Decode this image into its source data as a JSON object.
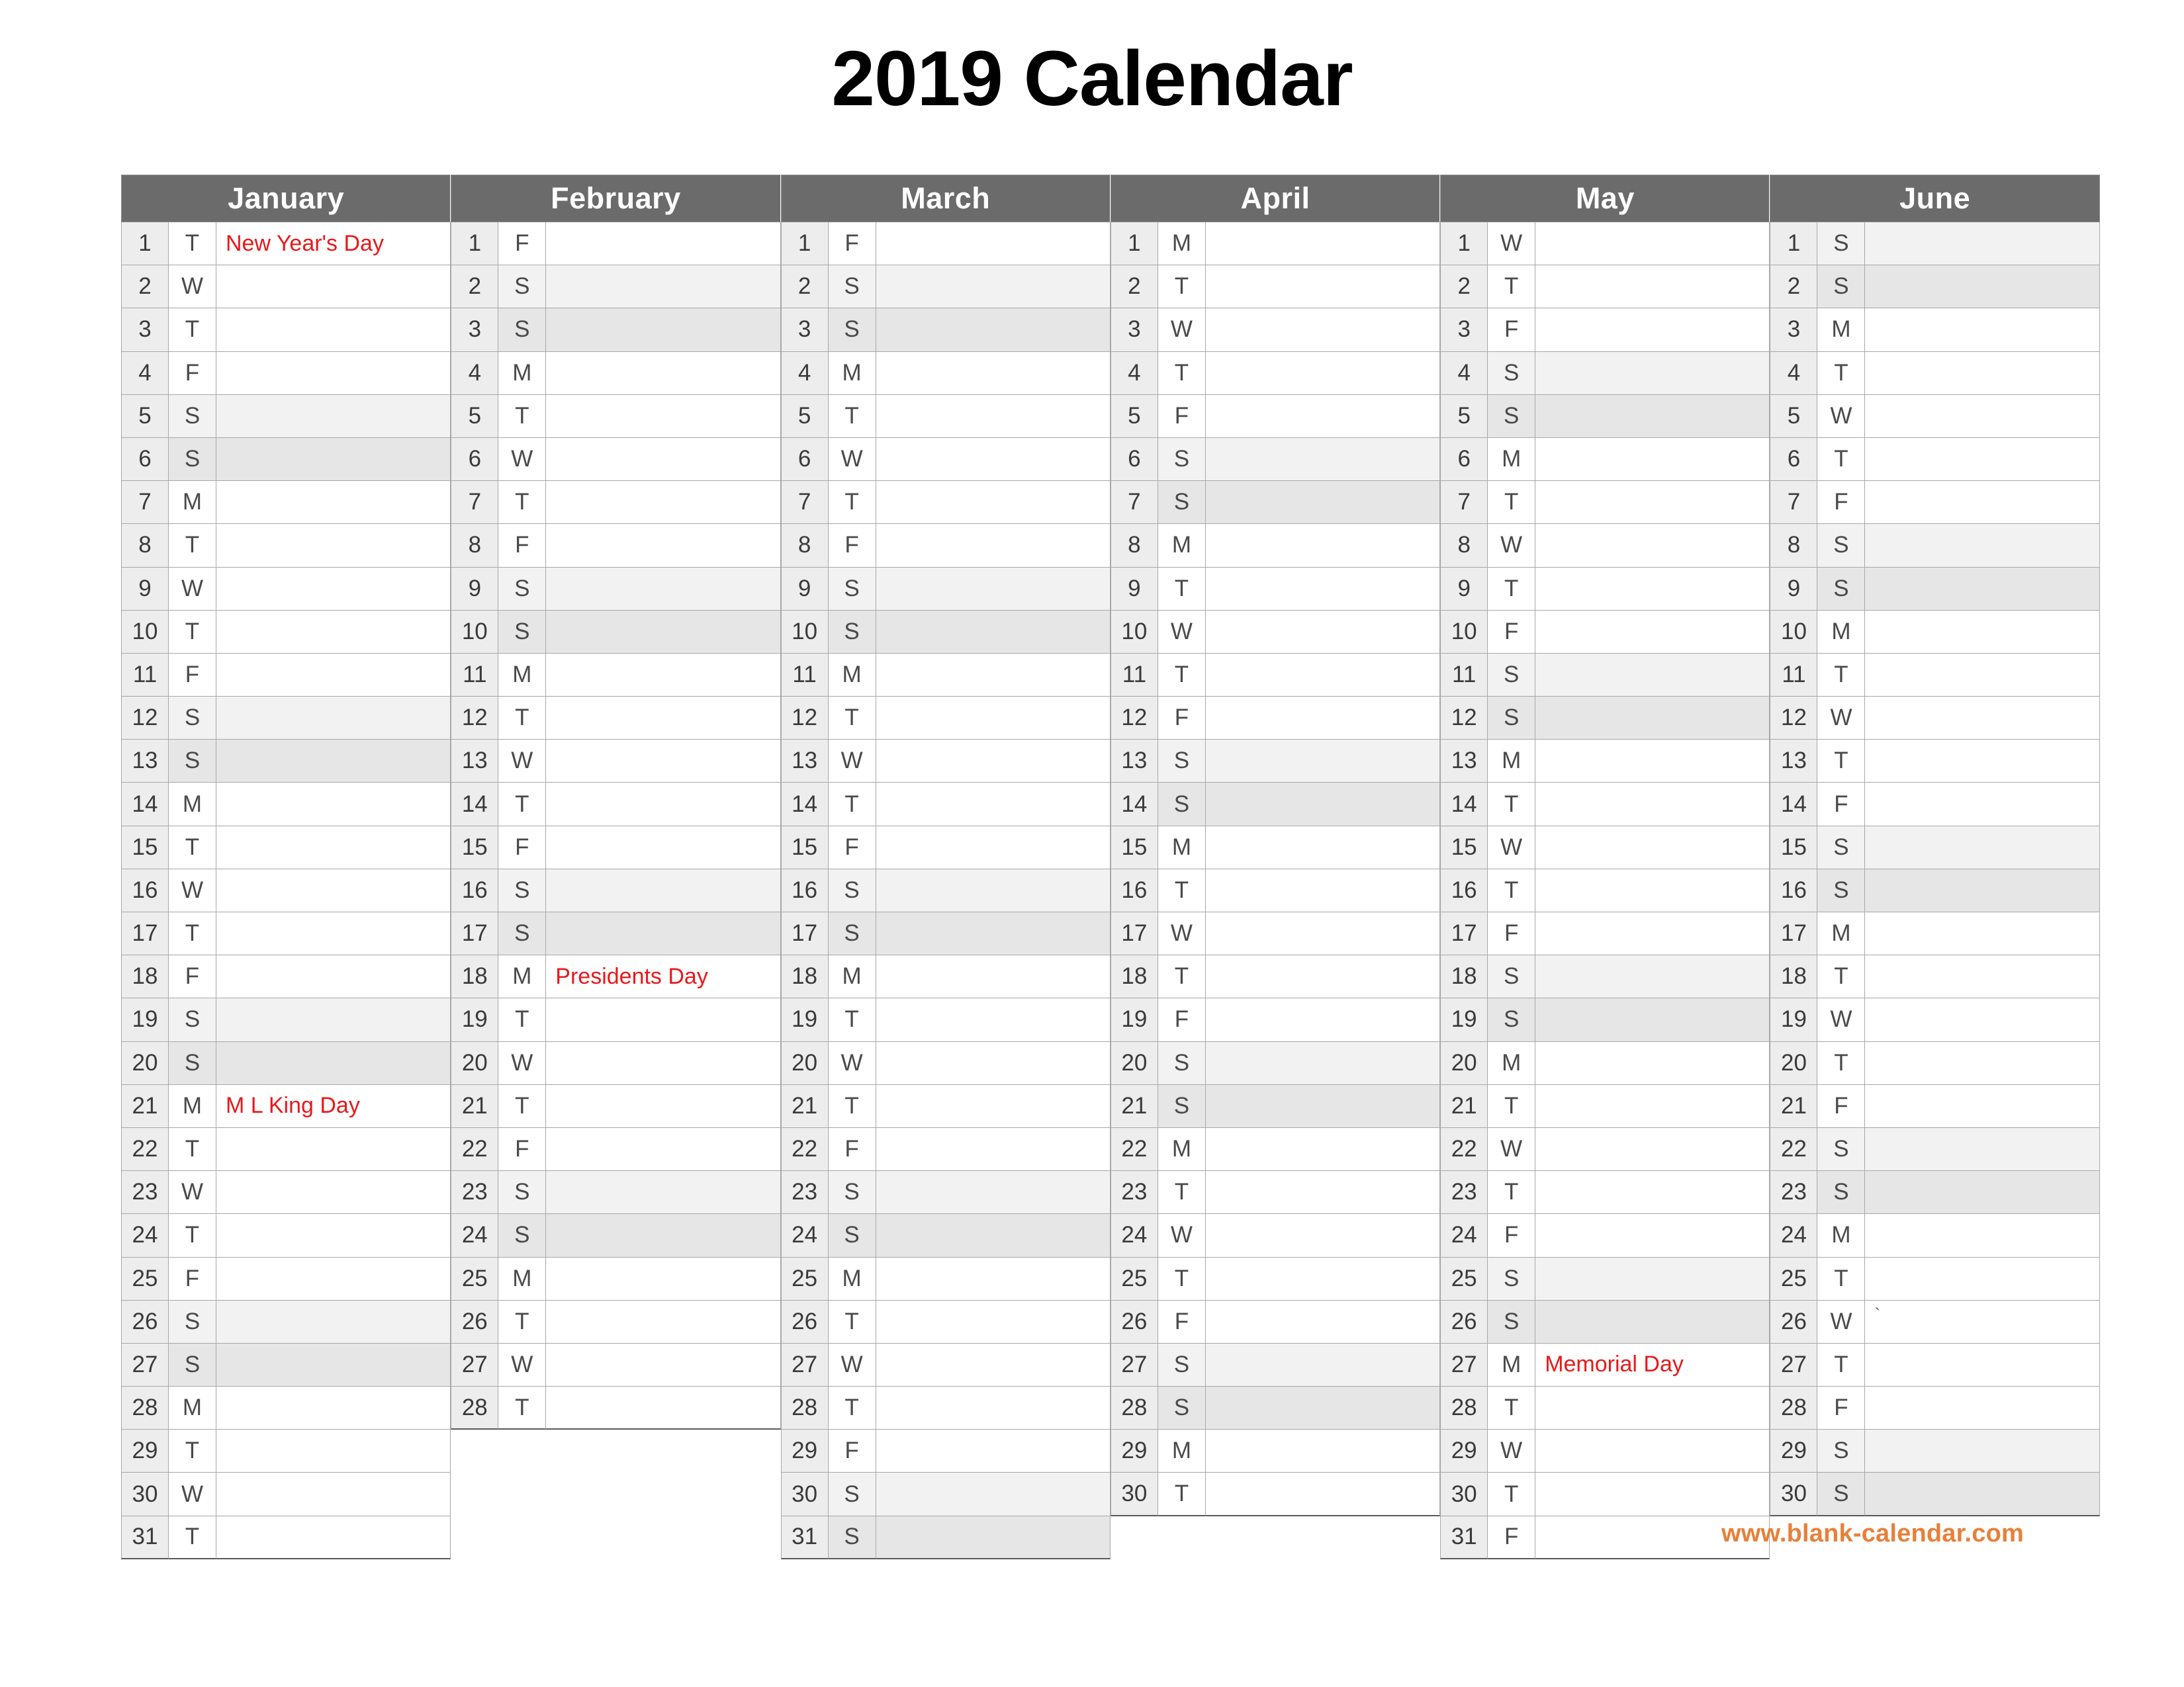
{
  "page": {
    "title": "2019 Calendar",
    "footer_url": "www.blank-calendar.com"
  },
  "colors": {
    "header_bg": "#6b6b6b",
    "header_text": "#ffffff",
    "daynum_bg": "#ededed",
    "saturday_bg": "#f2f2f2",
    "sunday_bg": "#e6e6e6",
    "holiday_text": "#e8191b",
    "url_text": "#e8803a",
    "grid_line": "#a8a8a8",
    "page_bg": "#ffffff"
  },
  "months": [
    {
      "name": "January",
      "num_days": 31,
      "days": [
        {
          "n": 1,
          "dow": "T",
          "event": "New Year's Day",
          "holiday": true
        },
        {
          "n": 2,
          "dow": "W",
          "event": ""
        },
        {
          "n": 3,
          "dow": "T",
          "event": ""
        },
        {
          "n": 4,
          "dow": "F",
          "event": ""
        },
        {
          "n": 5,
          "dow": "S",
          "event": "",
          "weekend": "sat"
        },
        {
          "n": 6,
          "dow": "S",
          "event": "",
          "weekend": "sun"
        },
        {
          "n": 7,
          "dow": "M",
          "event": ""
        },
        {
          "n": 8,
          "dow": "T",
          "event": ""
        },
        {
          "n": 9,
          "dow": "W",
          "event": ""
        },
        {
          "n": 10,
          "dow": "T",
          "event": ""
        },
        {
          "n": 11,
          "dow": "F",
          "event": ""
        },
        {
          "n": 12,
          "dow": "S",
          "event": "",
          "weekend": "sat"
        },
        {
          "n": 13,
          "dow": "S",
          "event": "",
          "weekend": "sun"
        },
        {
          "n": 14,
          "dow": "M",
          "event": ""
        },
        {
          "n": 15,
          "dow": "T",
          "event": ""
        },
        {
          "n": 16,
          "dow": "W",
          "event": ""
        },
        {
          "n": 17,
          "dow": "T",
          "event": ""
        },
        {
          "n": 18,
          "dow": "F",
          "event": ""
        },
        {
          "n": 19,
          "dow": "S",
          "event": "",
          "weekend": "sat"
        },
        {
          "n": 20,
          "dow": "S",
          "event": "",
          "weekend": "sun"
        },
        {
          "n": 21,
          "dow": "M",
          "event": "M L King Day",
          "holiday": true
        },
        {
          "n": 22,
          "dow": "T",
          "event": ""
        },
        {
          "n": 23,
          "dow": "W",
          "event": ""
        },
        {
          "n": 24,
          "dow": "T",
          "event": ""
        },
        {
          "n": 25,
          "dow": "F",
          "event": ""
        },
        {
          "n": 26,
          "dow": "S",
          "event": "",
          "weekend": "sat"
        },
        {
          "n": 27,
          "dow": "S",
          "event": "",
          "weekend": "sun"
        },
        {
          "n": 28,
          "dow": "M",
          "event": ""
        },
        {
          "n": 29,
          "dow": "T",
          "event": ""
        },
        {
          "n": 30,
          "dow": "W",
          "event": ""
        },
        {
          "n": 31,
          "dow": "T",
          "event": ""
        }
      ]
    },
    {
      "name": "February",
      "num_days": 28,
      "days": [
        {
          "n": 1,
          "dow": "F",
          "event": ""
        },
        {
          "n": 2,
          "dow": "S",
          "event": "",
          "weekend": "sat"
        },
        {
          "n": 3,
          "dow": "S",
          "event": "",
          "weekend": "sun"
        },
        {
          "n": 4,
          "dow": "M",
          "event": ""
        },
        {
          "n": 5,
          "dow": "T",
          "event": ""
        },
        {
          "n": 6,
          "dow": "W",
          "event": ""
        },
        {
          "n": 7,
          "dow": "T",
          "event": ""
        },
        {
          "n": 8,
          "dow": "F",
          "event": ""
        },
        {
          "n": 9,
          "dow": "S",
          "event": "",
          "weekend": "sat"
        },
        {
          "n": 10,
          "dow": "S",
          "event": "",
          "weekend": "sun"
        },
        {
          "n": 11,
          "dow": "M",
          "event": ""
        },
        {
          "n": 12,
          "dow": "T",
          "event": ""
        },
        {
          "n": 13,
          "dow": "W",
          "event": ""
        },
        {
          "n": 14,
          "dow": "T",
          "event": ""
        },
        {
          "n": 15,
          "dow": "F",
          "event": ""
        },
        {
          "n": 16,
          "dow": "S",
          "event": "",
          "weekend": "sat"
        },
        {
          "n": 17,
          "dow": "S",
          "event": "",
          "weekend": "sun"
        },
        {
          "n": 18,
          "dow": "M",
          "event": "Presidents Day",
          "holiday": true
        },
        {
          "n": 19,
          "dow": "T",
          "event": ""
        },
        {
          "n": 20,
          "dow": "W",
          "event": ""
        },
        {
          "n": 21,
          "dow": "T",
          "event": ""
        },
        {
          "n": 22,
          "dow": "F",
          "event": ""
        },
        {
          "n": 23,
          "dow": "S",
          "event": "",
          "weekend": "sat"
        },
        {
          "n": 24,
          "dow": "S",
          "event": "",
          "weekend": "sun"
        },
        {
          "n": 25,
          "dow": "M",
          "event": ""
        },
        {
          "n": 26,
          "dow": "T",
          "event": ""
        },
        {
          "n": 27,
          "dow": "W",
          "event": ""
        },
        {
          "n": 28,
          "dow": "T",
          "event": ""
        }
      ]
    },
    {
      "name": "March",
      "num_days": 31,
      "days": [
        {
          "n": 1,
          "dow": "F",
          "event": ""
        },
        {
          "n": 2,
          "dow": "S",
          "event": "",
          "weekend": "sat"
        },
        {
          "n": 3,
          "dow": "S",
          "event": "",
          "weekend": "sun"
        },
        {
          "n": 4,
          "dow": "M",
          "event": ""
        },
        {
          "n": 5,
          "dow": "T",
          "event": ""
        },
        {
          "n": 6,
          "dow": "W",
          "event": ""
        },
        {
          "n": 7,
          "dow": "T",
          "event": ""
        },
        {
          "n": 8,
          "dow": "F",
          "event": ""
        },
        {
          "n": 9,
          "dow": "S",
          "event": "",
          "weekend": "sat"
        },
        {
          "n": 10,
          "dow": "S",
          "event": "",
          "weekend": "sun"
        },
        {
          "n": 11,
          "dow": "M",
          "event": ""
        },
        {
          "n": 12,
          "dow": "T",
          "event": ""
        },
        {
          "n": 13,
          "dow": "W",
          "event": ""
        },
        {
          "n": 14,
          "dow": "T",
          "event": ""
        },
        {
          "n": 15,
          "dow": "F",
          "event": ""
        },
        {
          "n": 16,
          "dow": "S",
          "event": "",
          "weekend": "sat"
        },
        {
          "n": 17,
          "dow": "S",
          "event": "",
          "weekend": "sun"
        },
        {
          "n": 18,
          "dow": "M",
          "event": ""
        },
        {
          "n": 19,
          "dow": "T",
          "event": ""
        },
        {
          "n": 20,
          "dow": "W",
          "event": ""
        },
        {
          "n": 21,
          "dow": "T",
          "event": ""
        },
        {
          "n": 22,
          "dow": "F",
          "event": ""
        },
        {
          "n": 23,
          "dow": "S",
          "event": "",
          "weekend": "sat"
        },
        {
          "n": 24,
          "dow": "S",
          "event": "",
          "weekend": "sun"
        },
        {
          "n": 25,
          "dow": "M",
          "event": ""
        },
        {
          "n": 26,
          "dow": "T",
          "event": ""
        },
        {
          "n": 27,
          "dow": "W",
          "event": ""
        },
        {
          "n": 28,
          "dow": "T",
          "event": ""
        },
        {
          "n": 29,
          "dow": "F",
          "event": ""
        },
        {
          "n": 30,
          "dow": "S",
          "event": "",
          "weekend": "sat"
        },
        {
          "n": 31,
          "dow": "S",
          "event": "",
          "weekend": "sun"
        }
      ]
    },
    {
      "name": "April",
      "num_days": 30,
      "days": [
        {
          "n": 1,
          "dow": "M",
          "event": ""
        },
        {
          "n": 2,
          "dow": "T",
          "event": ""
        },
        {
          "n": 3,
          "dow": "W",
          "event": ""
        },
        {
          "n": 4,
          "dow": "T",
          "event": ""
        },
        {
          "n": 5,
          "dow": "F",
          "event": ""
        },
        {
          "n": 6,
          "dow": "S",
          "event": "",
          "weekend": "sat"
        },
        {
          "n": 7,
          "dow": "S",
          "event": "",
          "weekend": "sun"
        },
        {
          "n": 8,
          "dow": "M",
          "event": ""
        },
        {
          "n": 9,
          "dow": "T",
          "event": ""
        },
        {
          "n": 10,
          "dow": "W",
          "event": ""
        },
        {
          "n": 11,
          "dow": "T",
          "event": ""
        },
        {
          "n": 12,
          "dow": "F",
          "event": ""
        },
        {
          "n": 13,
          "dow": "S",
          "event": "",
          "weekend": "sat"
        },
        {
          "n": 14,
          "dow": "S",
          "event": "",
          "weekend": "sun"
        },
        {
          "n": 15,
          "dow": "M",
          "event": ""
        },
        {
          "n": 16,
          "dow": "T",
          "event": ""
        },
        {
          "n": 17,
          "dow": "W",
          "event": ""
        },
        {
          "n": 18,
          "dow": "T",
          "event": ""
        },
        {
          "n": 19,
          "dow": "F",
          "event": ""
        },
        {
          "n": 20,
          "dow": "S",
          "event": "",
          "weekend": "sat"
        },
        {
          "n": 21,
          "dow": "S",
          "event": "",
          "weekend": "sun"
        },
        {
          "n": 22,
          "dow": "M",
          "event": ""
        },
        {
          "n": 23,
          "dow": "T",
          "event": ""
        },
        {
          "n": 24,
          "dow": "W",
          "event": ""
        },
        {
          "n": 25,
          "dow": "T",
          "event": ""
        },
        {
          "n": 26,
          "dow": "F",
          "event": ""
        },
        {
          "n": 27,
          "dow": "S",
          "event": "",
          "weekend": "sat"
        },
        {
          "n": 28,
          "dow": "S",
          "event": "",
          "weekend": "sun"
        },
        {
          "n": 29,
          "dow": "M",
          "event": ""
        },
        {
          "n": 30,
          "dow": "T",
          "event": ""
        }
      ]
    },
    {
      "name": "May",
      "num_days": 31,
      "days": [
        {
          "n": 1,
          "dow": "W",
          "event": ""
        },
        {
          "n": 2,
          "dow": "T",
          "event": ""
        },
        {
          "n": 3,
          "dow": "F",
          "event": ""
        },
        {
          "n": 4,
          "dow": "S",
          "event": "",
          "weekend": "sat"
        },
        {
          "n": 5,
          "dow": "S",
          "event": "",
          "weekend": "sun"
        },
        {
          "n": 6,
          "dow": "M",
          "event": ""
        },
        {
          "n": 7,
          "dow": "T",
          "event": ""
        },
        {
          "n": 8,
          "dow": "W",
          "event": ""
        },
        {
          "n": 9,
          "dow": "T",
          "event": ""
        },
        {
          "n": 10,
          "dow": "F",
          "event": ""
        },
        {
          "n": 11,
          "dow": "S",
          "event": "",
          "weekend": "sat"
        },
        {
          "n": 12,
          "dow": "S",
          "event": "",
          "weekend": "sun"
        },
        {
          "n": 13,
          "dow": "M",
          "event": ""
        },
        {
          "n": 14,
          "dow": "T",
          "event": ""
        },
        {
          "n": 15,
          "dow": "W",
          "event": ""
        },
        {
          "n": 16,
          "dow": "T",
          "event": ""
        },
        {
          "n": 17,
          "dow": "F",
          "event": ""
        },
        {
          "n": 18,
          "dow": "S",
          "event": "",
          "weekend": "sat"
        },
        {
          "n": 19,
          "dow": "S",
          "event": "",
          "weekend": "sun"
        },
        {
          "n": 20,
          "dow": "M",
          "event": ""
        },
        {
          "n": 21,
          "dow": "T",
          "event": ""
        },
        {
          "n": 22,
          "dow": "W",
          "event": ""
        },
        {
          "n": 23,
          "dow": "T",
          "event": ""
        },
        {
          "n": 24,
          "dow": "F",
          "event": ""
        },
        {
          "n": 25,
          "dow": "S",
          "event": "",
          "weekend": "sat"
        },
        {
          "n": 26,
          "dow": "S",
          "event": "",
          "weekend": "sun"
        },
        {
          "n": 27,
          "dow": "M",
          "event": "Memorial Day",
          "holiday": true
        },
        {
          "n": 28,
          "dow": "T",
          "event": ""
        },
        {
          "n": 29,
          "dow": "W",
          "event": ""
        },
        {
          "n": 30,
          "dow": "T",
          "event": ""
        },
        {
          "n": 31,
          "dow": "F",
          "event": ""
        }
      ]
    },
    {
      "name": "June",
      "num_days": 30,
      "days": [
        {
          "n": 1,
          "dow": "S",
          "event": "",
          "weekend": "sat"
        },
        {
          "n": 2,
          "dow": "S",
          "event": "",
          "weekend": "sun"
        },
        {
          "n": 3,
          "dow": "M",
          "event": ""
        },
        {
          "n": 4,
          "dow": "T",
          "event": ""
        },
        {
          "n": 5,
          "dow": "W",
          "event": ""
        },
        {
          "n": 6,
          "dow": "T",
          "event": ""
        },
        {
          "n": 7,
          "dow": "F",
          "event": ""
        },
        {
          "n": 8,
          "dow": "S",
          "event": "",
          "weekend": "sat"
        },
        {
          "n": 9,
          "dow": "S",
          "event": "",
          "weekend": "sun"
        },
        {
          "n": 10,
          "dow": "M",
          "event": ""
        },
        {
          "n": 11,
          "dow": "T",
          "event": ""
        },
        {
          "n": 12,
          "dow": "W",
          "event": ""
        },
        {
          "n": 13,
          "dow": "T",
          "event": ""
        },
        {
          "n": 14,
          "dow": "F",
          "event": ""
        },
        {
          "n": 15,
          "dow": "S",
          "event": "",
          "weekend": "sat"
        },
        {
          "n": 16,
          "dow": "S",
          "event": "",
          "weekend": "sun"
        },
        {
          "n": 17,
          "dow": "M",
          "event": ""
        },
        {
          "n": 18,
          "dow": "T",
          "event": ""
        },
        {
          "n": 19,
          "dow": "W",
          "event": ""
        },
        {
          "n": 20,
          "dow": "T",
          "event": ""
        },
        {
          "n": 21,
          "dow": "F",
          "event": ""
        },
        {
          "n": 22,
          "dow": "S",
          "event": "",
          "weekend": "sat"
        },
        {
          "n": 23,
          "dow": "S",
          "event": "",
          "weekend": "sun"
        },
        {
          "n": 24,
          "dow": "M",
          "event": ""
        },
        {
          "n": 25,
          "dow": "T",
          "event": ""
        },
        {
          "n": 26,
          "dow": "W",
          "event": "`"
        },
        {
          "n": 27,
          "dow": "T",
          "event": ""
        },
        {
          "n": 28,
          "dow": "F",
          "event": ""
        },
        {
          "n": 29,
          "dow": "S",
          "event": "",
          "weekend": "sat"
        },
        {
          "n": 30,
          "dow": "S",
          "event": "",
          "weekend": "sun"
        }
      ]
    }
  ]
}
